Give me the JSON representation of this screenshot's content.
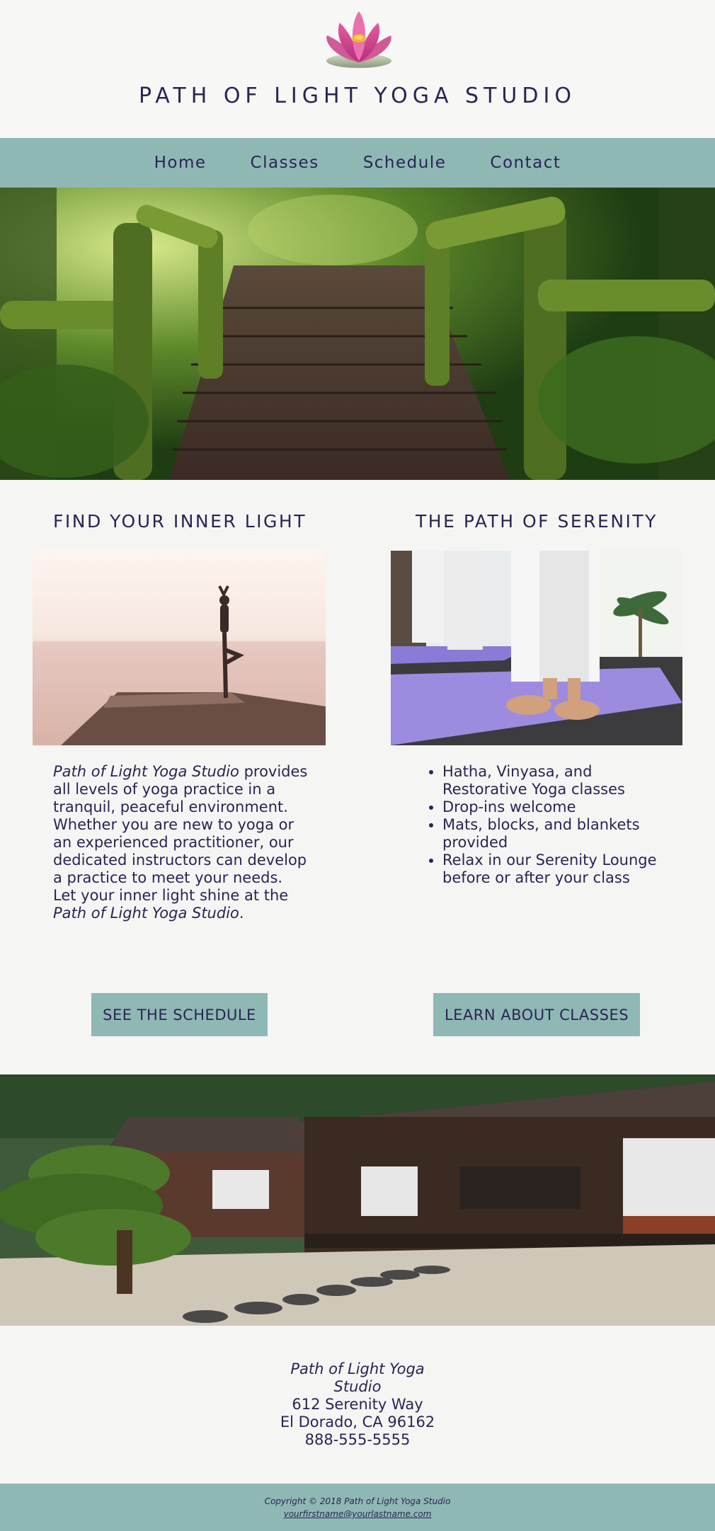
{
  "header": {
    "title": "PATH OF LIGHT YOGA STUDIO",
    "logo_icon": "lotus-flower-icon"
  },
  "nav": {
    "items": [
      {
        "label": "Home"
      },
      {
        "label": "Classes"
      },
      {
        "label": "Schedule"
      },
      {
        "label": "Contact"
      }
    ]
  },
  "left_column": {
    "heading": "FIND YOUR INNER LIGHT",
    "intro_lead": "Path of Light Yoga Studio",
    "intro_body": " provides all levels of yoga practice in a tranquil, peaceful environment. Whether you are new to yoga or an experienced practitioner, our dedicated instructors can develop a practice to meet your needs. Let your inner light shine at the ",
    "intro_tail": "Path of Light Yoga Studio",
    "intro_end": ".",
    "button_label": "SEE THE SCHEDULE"
  },
  "right_column": {
    "heading": "THE PATH OF SERENITY",
    "features": [
      "Hatha, Vinyasa, and Restorative Yoga classes",
      "Drop-ins welcome",
      "Mats, blocks, and blankets provided",
      "Relax in our Serenity Lounge before or after your class"
    ],
    "button_label": "LEARN ABOUT CLASSES"
  },
  "contact": {
    "studio": "Path of Light Yoga Studio",
    "street": "612 Serenity Way",
    "city": "El Dorado, CA 96162",
    "phone": "888-555-5555"
  },
  "footer": {
    "copyright": "Copyright © 2018 Path of Light Yoga Studio",
    "email": "yourfirstname@yourlastname.com"
  },
  "colors": {
    "accent": "#8fb8b5",
    "text": "#2b2455",
    "background": "#f5f5f3"
  }
}
